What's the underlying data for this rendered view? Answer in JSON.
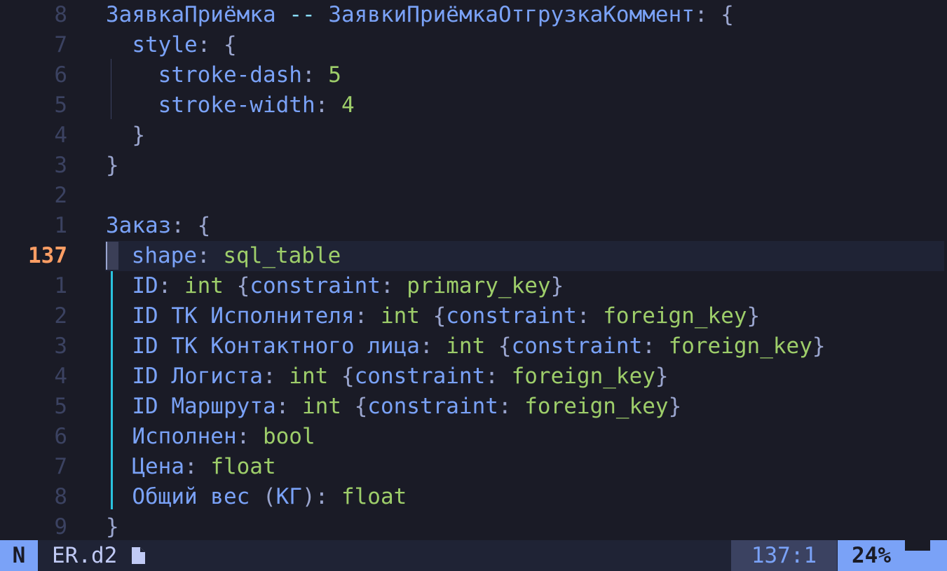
{
  "editor": {
    "lines": [
      {
        "num": "8",
        "segments": [
          [
            "k",
            "ЗаявкаПриёмка"
          ],
          [
            "p",
            " "
          ],
          [
            "op",
            "--"
          ],
          [
            "p",
            " "
          ],
          [
            "k",
            "ЗаявкиПриёмкаОтгрузкаКоммент"
          ],
          [
            "p",
            ": {"
          ]
        ]
      },
      {
        "num": "7",
        "segments": [
          [
            "p",
            "  "
          ],
          [
            "k",
            "style"
          ],
          [
            "p",
            ": {"
          ]
        ]
      },
      {
        "num": "6",
        "segments": [
          [
            "p",
            "    "
          ],
          [
            "k",
            "stroke-dash"
          ],
          [
            "p",
            ": "
          ],
          [
            "v",
            "5"
          ]
        ]
      },
      {
        "num": "5",
        "segments": [
          [
            "p",
            "    "
          ],
          [
            "k",
            "stroke-width"
          ],
          [
            "p",
            ": "
          ],
          [
            "v",
            "4"
          ]
        ]
      },
      {
        "num": "4",
        "segments": [
          [
            "p",
            "  }"
          ]
        ]
      },
      {
        "num": "3",
        "segments": [
          [
            "p",
            "}"
          ]
        ]
      },
      {
        "num": "2",
        "segments": []
      },
      {
        "num": "1",
        "segments": [
          [
            "k",
            "Заказ"
          ],
          [
            "p",
            ": {"
          ]
        ]
      },
      {
        "num": "137",
        "current": true,
        "segments": [
          [
            "k",
            "shape"
          ],
          [
            "p",
            ": "
          ],
          [
            "v",
            "sql_table"
          ]
        ]
      },
      {
        "num": "1",
        "segments": [
          [
            "p",
            "  "
          ],
          [
            "k",
            "ID"
          ],
          [
            "p",
            ": "
          ],
          [
            "v",
            "int"
          ],
          [
            "p",
            " {"
          ],
          [
            "k",
            "constraint"
          ],
          [
            "p",
            ": "
          ],
          [
            "v",
            "primary_key"
          ],
          [
            "p",
            "}"
          ]
        ]
      },
      {
        "num": "2",
        "segments": [
          [
            "p",
            "  "
          ],
          [
            "k",
            "ID ТК Исполнителя"
          ],
          [
            "p",
            ": "
          ],
          [
            "v",
            "int"
          ],
          [
            "p",
            " {"
          ],
          [
            "k",
            "constraint"
          ],
          [
            "p",
            ": "
          ],
          [
            "v",
            "foreign_key"
          ],
          [
            "p",
            "}"
          ]
        ]
      },
      {
        "num": "3",
        "segments": [
          [
            "p",
            "  "
          ],
          [
            "k",
            "ID ТК Контактного лица"
          ],
          [
            "p",
            ": "
          ],
          [
            "v",
            "int"
          ],
          [
            "p",
            " {"
          ],
          [
            "k",
            "constraint"
          ],
          [
            "p",
            ": "
          ],
          [
            "v",
            "foreign_key"
          ],
          [
            "p",
            "}"
          ]
        ]
      },
      {
        "num": "4",
        "segments": [
          [
            "p",
            "  "
          ],
          [
            "k",
            "ID Логиста"
          ],
          [
            "p",
            ": "
          ],
          [
            "v",
            "int"
          ],
          [
            "p",
            " {"
          ],
          [
            "k",
            "constraint"
          ],
          [
            "p",
            ": "
          ],
          [
            "v",
            "foreign_key"
          ],
          [
            "p",
            "}"
          ]
        ]
      },
      {
        "num": "5",
        "segments": [
          [
            "p",
            "  "
          ],
          [
            "k",
            "ID Маршрута"
          ],
          [
            "p",
            ": "
          ],
          [
            "v",
            "int"
          ],
          [
            "p",
            " {"
          ],
          [
            "k",
            "constraint"
          ],
          [
            "p",
            ": "
          ],
          [
            "v",
            "foreign_key"
          ],
          [
            "p",
            "}"
          ]
        ]
      },
      {
        "num": "6",
        "segments": [
          [
            "p",
            "  "
          ],
          [
            "k",
            "Исполнен"
          ],
          [
            "p",
            ": "
          ],
          [
            "v",
            "bool"
          ]
        ]
      },
      {
        "num": "7",
        "segments": [
          [
            "p",
            "  "
          ],
          [
            "k",
            "Цена"
          ],
          [
            "p",
            ": "
          ],
          [
            "v",
            "float"
          ]
        ]
      },
      {
        "num": "8",
        "segments": [
          [
            "p",
            "  "
          ],
          [
            "k",
            "Общий вес "
          ],
          [
            "p",
            "("
          ],
          [
            "k",
            "КГ"
          ],
          [
            "p",
            "): "
          ],
          [
            "v",
            "float"
          ]
        ]
      },
      {
        "num": "9",
        "segments": [
          [
            "p",
            "}"
          ]
        ]
      }
    ]
  },
  "statusbar": {
    "mode": "N",
    "filename": "ER.d2",
    "file_icon": "file-icon",
    "position": "137:1",
    "percent": "24%"
  },
  "colors": {
    "background": "#1a1b26",
    "key": "#7aa2f7",
    "value": "#9ece6a",
    "punct": "#9aa5ce",
    "current_line_number": "#ff9e64",
    "line_number": "#3b4261",
    "indent_guide_active": "#2ac3de"
  }
}
